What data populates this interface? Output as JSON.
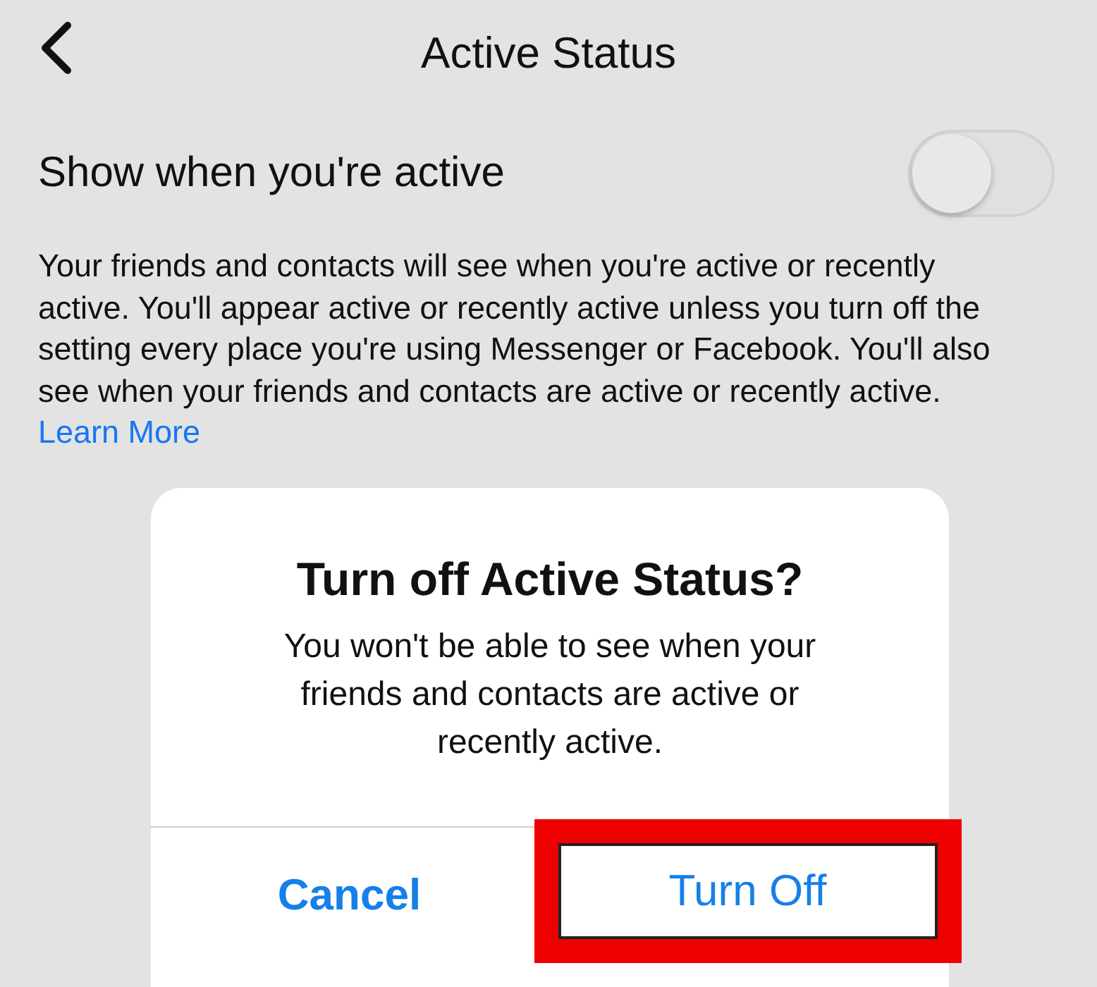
{
  "header": {
    "title": "Active Status"
  },
  "setting": {
    "label": "Show when you're active",
    "on": false
  },
  "description": {
    "text": "Your friends and contacts will see when you're active or recently active. You'll appear active or recently active unless you turn off the setting every place you're using Messenger or Facebook. You'll also see when your friends and contacts are active or recently active.",
    "link": "Learn More"
  },
  "dialog": {
    "title": "Turn off Active Status?",
    "message": "You won't be able to see when your friends and contacts are active or recently active.",
    "buttons": [
      {
        "label": "Cancel",
        "bold": true,
        "highlighted": false
      },
      {
        "label": "Turn Off",
        "bold": false,
        "highlighted": true
      }
    ]
  }
}
